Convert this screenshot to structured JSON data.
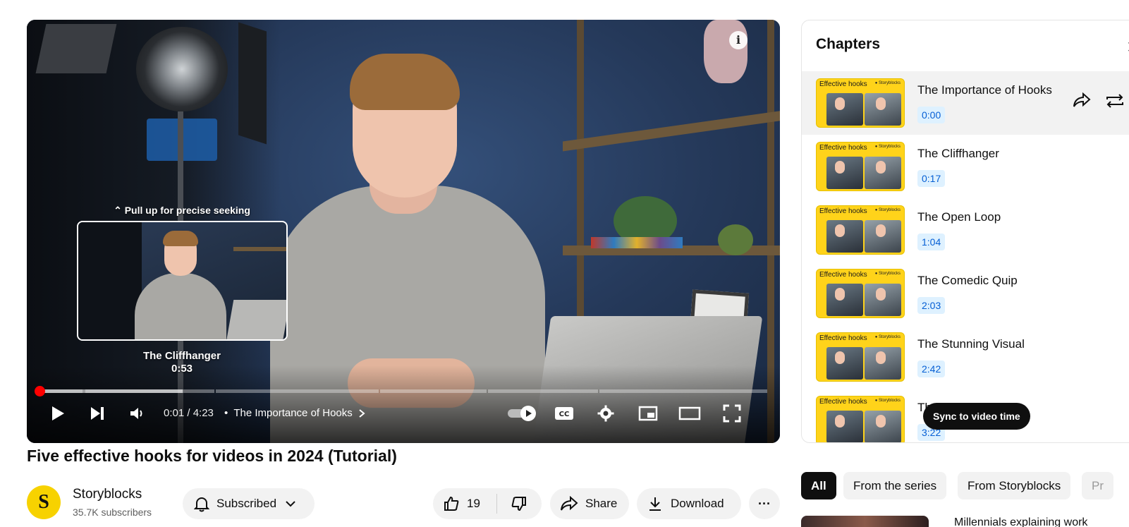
{
  "player": {
    "seek_hint": "⌃ Pull up for precise seeking",
    "preview_chapter": "The Cliffhanger",
    "preview_time": "0:53",
    "time_display": "0:01 / 4:23",
    "chapter_separator": "•",
    "current_chapter": "The Importance of Hooks",
    "info_icon": "i",
    "progress": {
      "played_fraction": 0.004,
      "buffered_fraction": 0.2,
      "duration_seconds": 263,
      "chapter_starts_seconds": [
        0,
        17,
        64,
        123,
        162,
        202
      ]
    },
    "controls": [
      "play-icon",
      "next-icon",
      "volume-icon",
      "autoplay-toggle",
      "cc-icon",
      "settings-icon",
      "miniplayer-icon",
      "theater-icon",
      "fullscreen-icon"
    ]
  },
  "video": {
    "title": "Five effective hooks for videos in 2024 (Tutorial)",
    "channel_name": "Storyblocks",
    "channel_initial": "S",
    "subscribers": "35.7K subscribers",
    "subscribe_label": "Subscribed",
    "like_count": "19",
    "share_label": "Share",
    "download_label": "Download",
    "more_label": "···"
  },
  "chapters_panel": {
    "title": "Chapters",
    "close_label": "✕",
    "thumb_text": "Effective hooks",
    "thumb_logo": "● Storyblocks",
    "items": [
      {
        "title": "The Importance of Hooks",
        "time": "0:00",
        "active": true
      },
      {
        "title": "The Cliffhanger",
        "time": "0:17",
        "active": false
      },
      {
        "title": "The Open Loop",
        "time": "1:04",
        "active": false
      },
      {
        "title": "The Comedic Quip",
        "time": "2:03",
        "active": false
      },
      {
        "title": "The Stunning Visual",
        "time": "2:42",
        "active": false
      },
      {
        "title": "Th",
        "time": "3:22",
        "active": false
      }
    ],
    "tooltip": "Sync to video time"
  },
  "filter_chips": [
    {
      "label": "All",
      "active": true
    },
    {
      "label": "From the series",
      "active": false
    },
    {
      "label": "From Storyblocks",
      "active": false
    },
    {
      "label": "Pr",
      "active": false
    }
  ],
  "recommendations": [
    {
      "title": "Millennials explaining work"
    }
  ],
  "colors": {
    "accent_red": "#ff0000",
    "chip_active_bg": "#0f0f0f",
    "pill_bg": "#f2f2f2",
    "timestamp_bg": "#def1ff",
    "timestamp_text": "#065fd4",
    "brand_yellow": "#f7d200"
  }
}
